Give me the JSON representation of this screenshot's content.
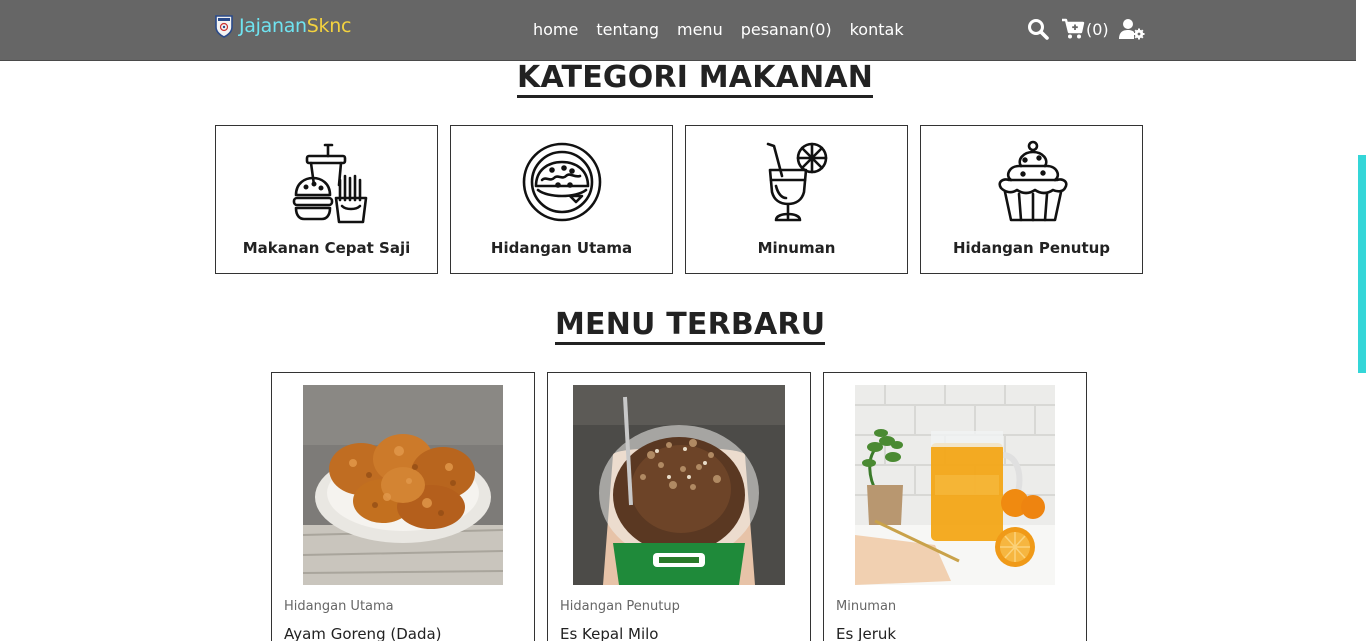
{
  "navbar": {
    "logo": {
      "part1": "Jajanan",
      "part2": "Sknc"
    },
    "links": [
      "home",
      "tentang",
      "menu",
      "pesanan(0)",
      "kontak"
    ],
    "cart_count": "(0)",
    "icons": [
      "search-icon",
      "cart-plus-icon",
      "user-cog-icon"
    ],
    "bg_color": "#666666"
  },
  "categories": {
    "title": "KATEGORI MAKANAN",
    "items": [
      {
        "label": "Makanan Cepat Saji",
        "icon": "fast-food-icon"
      },
      {
        "label": "Hidangan Utama",
        "icon": "main-dish-icon"
      },
      {
        "label": "Minuman",
        "icon": "drink-icon"
      },
      {
        "label": "Hidangan Penutup",
        "icon": "cupcake-icon"
      }
    ]
  },
  "menu": {
    "title": "MENU TERBARU",
    "items": [
      {
        "category": "Hidangan Utama",
        "name": "Ayam Goreng (Dada)"
      },
      {
        "category": "Hidangan Penutup",
        "name": "Es Kepal Milo"
      },
      {
        "category": "Minuman",
        "name": "Es Jeruk"
      }
    ]
  },
  "colors": {
    "accent_scroll": "#34d6d8",
    "logo_cyan": "#6fe3f0",
    "logo_yellow": "#f3d23f"
  }
}
